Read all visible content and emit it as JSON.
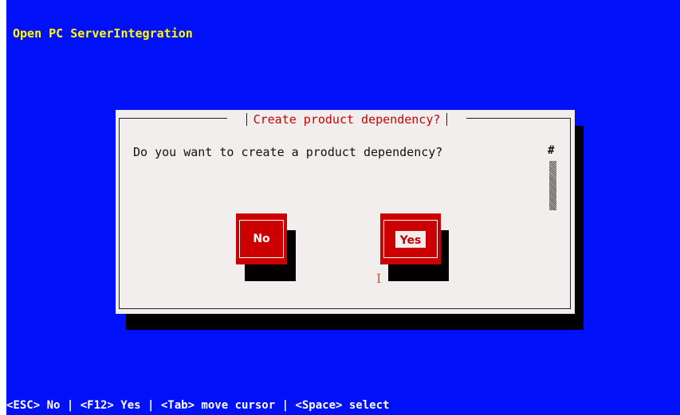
{
  "app": {
    "title": "Open PC ServerIntegration"
  },
  "dialog": {
    "title": "Create product dependency?",
    "question": "Do you want to create a product dependency?",
    "scroll_indicator": "#"
  },
  "buttons": {
    "no_label": "No",
    "yes_label": "Yes",
    "focused": "Yes"
  },
  "status_bar": {
    "text": "<ESC> No | <F12> Yes | <Tab> move cursor | <Space> select"
  },
  "colors": {
    "background": "#0010f8",
    "title_text": "#ffff00",
    "dialog_bg": "#f2eeee",
    "accent_red": "#cc0000",
    "shadow": "#000000"
  },
  "icons": {
    "text_cursor": "i-beam-cursor-icon"
  }
}
